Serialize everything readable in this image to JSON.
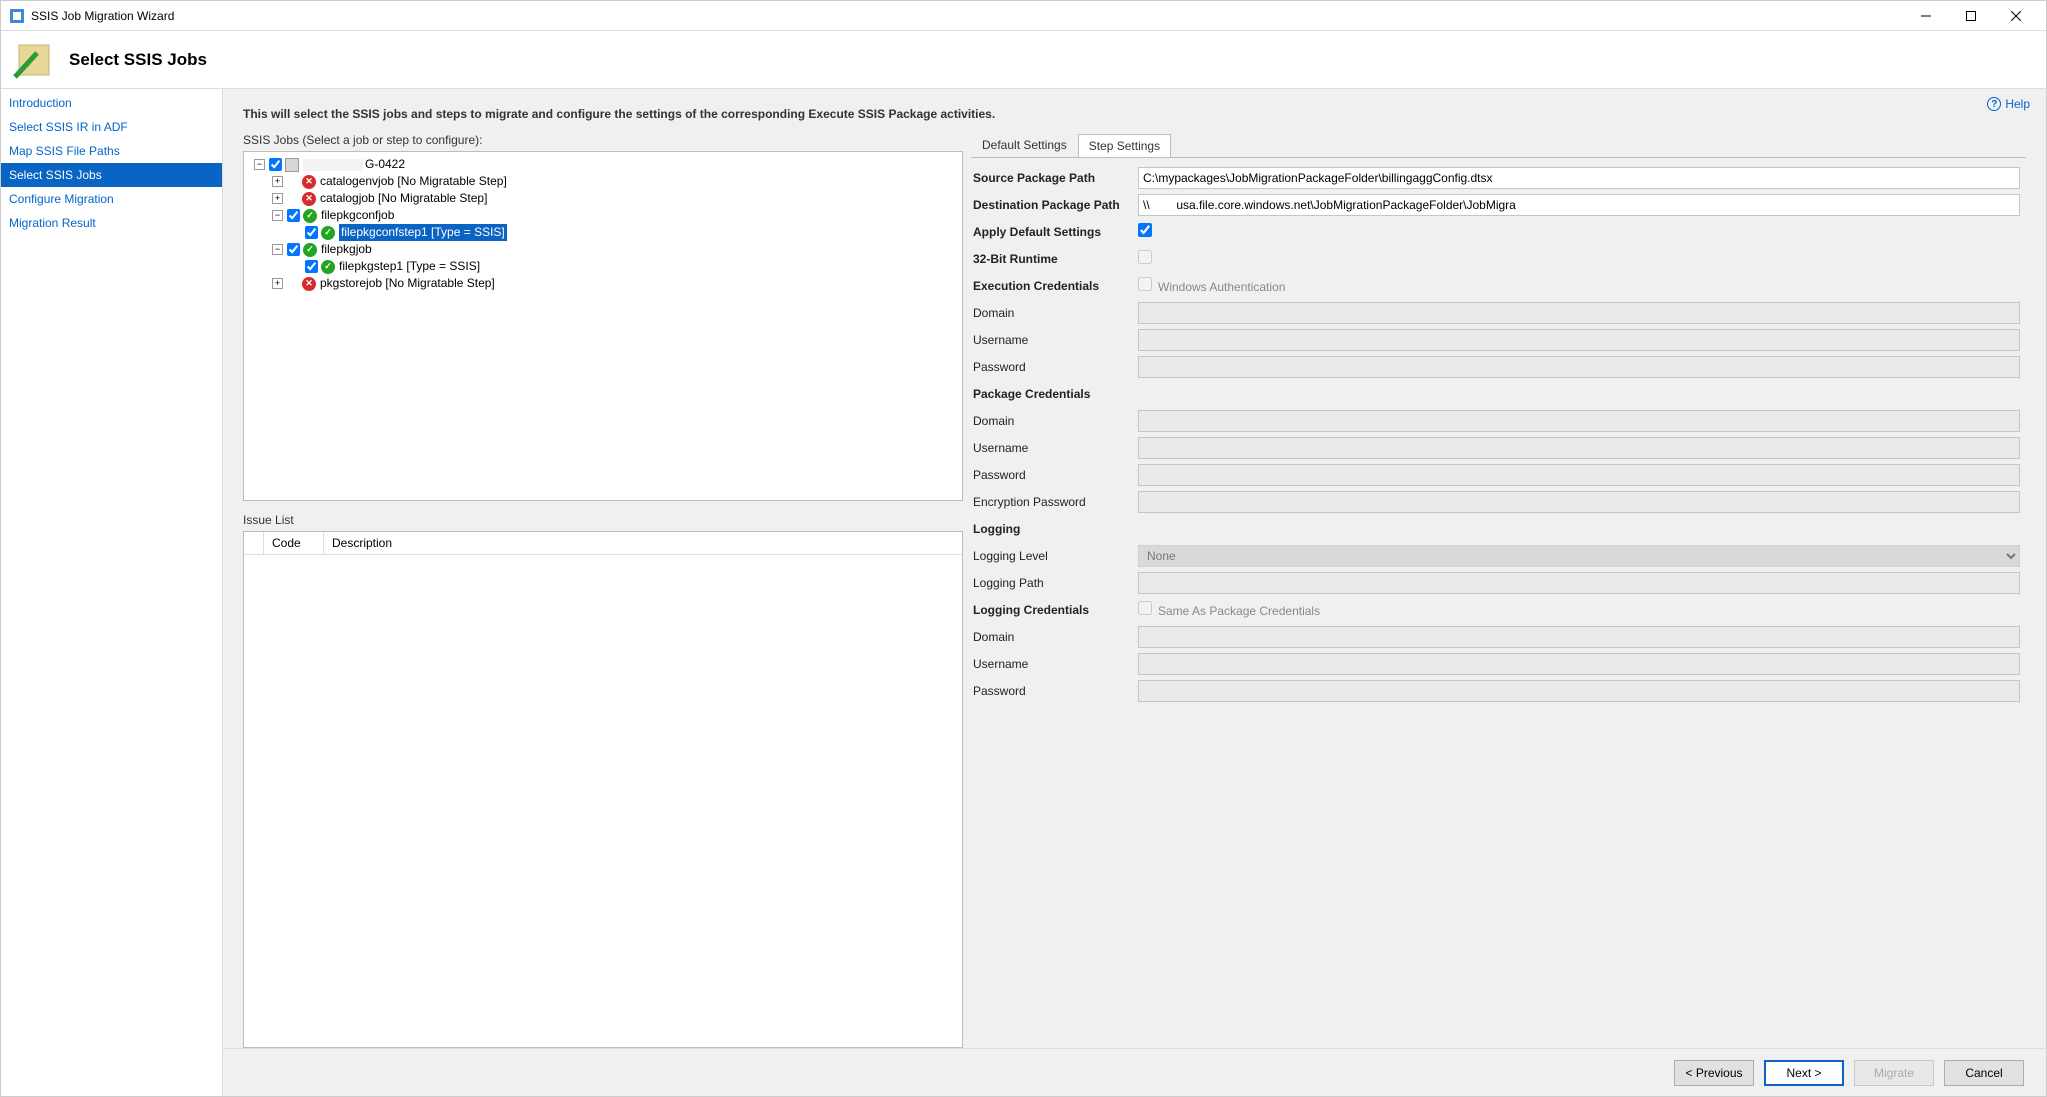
{
  "window_title": "SSIS Job Migration Wizard",
  "page_title": "Select SSIS Jobs",
  "help_label": "Help",
  "nav": {
    "items": [
      {
        "label": "Introduction",
        "active": false
      },
      {
        "label": "Select SSIS IR in ADF",
        "active": false
      },
      {
        "label": "Map SSIS File Paths",
        "active": false
      },
      {
        "label": "Select SSIS Jobs",
        "active": true
      },
      {
        "label": "Configure Migration",
        "active": false
      },
      {
        "label": "Migration Result",
        "active": false
      }
    ]
  },
  "description": "This will select the SSIS jobs and steps to migrate and configure the settings of the corresponding Execute SSIS Package activities.",
  "tree_label": "SSIS Jobs (Select a job or step to configure):",
  "tree": {
    "root": {
      "label": "G-0422",
      "checked": true
    },
    "nodes": [
      {
        "label": "catalogenvjob [No Migratable Step]",
        "status": "bad",
        "exp": "+"
      },
      {
        "label": "catalogjob [No Migratable Step]",
        "status": "bad",
        "exp": "+"
      },
      {
        "label": "filepkgconfjob",
        "status": "ok",
        "checked": true,
        "exp": "-",
        "children": [
          {
            "label": "filepkgconfstep1 [Type = SSIS]",
            "status": "ok",
            "checked": true,
            "selected": true
          }
        ]
      },
      {
        "label": "filepkgjob",
        "status": "ok",
        "checked": true,
        "exp": "-",
        "children": [
          {
            "label": "filepkgstep1 [Type = SSIS]",
            "status": "ok",
            "checked": true
          }
        ]
      },
      {
        "label": "pkgstorejob [No Migratable Step]",
        "status": "bad",
        "exp": "+"
      }
    ]
  },
  "issue_title": "Issue List",
  "issue_cols": {
    "code": "Code",
    "desc": "Description"
  },
  "tabs": {
    "default": "Default Settings",
    "step": "Step Settings"
  },
  "form": {
    "source_path": {
      "label": "Source Package Path",
      "value": "C:\\mypackages\\JobMigrationPackageFolder\\billingaggConfig.dtsx"
    },
    "dest_path": {
      "label": "Destination Package Path",
      "value": "\\\\        usa.file.core.windows.net\\JobMigrationPackageFolder\\JobMigra"
    },
    "apply_defaults": {
      "label": "Apply Default Settings",
      "checked": true
    },
    "runtime32": {
      "label": "32-Bit Runtime",
      "checked": false
    },
    "exec_cred": {
      "label": "Execution Credentials",
      "chk_label": "Windows Authentication"
    },
    "exec_domain": {
      "label": "Domain",
      "value": ""
    },
    "exec_user": {
      "label": "Username",
      "value": ""
    },
    "exec_pass": {
      "label": "Password",
      "value": ""
    },
    "pkg_cred": {
      "label": "Package Credentials"
    },
    "pkg_domain": {
      "label": "Domain",
      "value": ""
    },
    "pkg_user": {
      "label": "Username",
      "value": ""
    },
    "pkg_pass": {
      "label": "Password",
      "value": ""
    },
    "enc_pass": {
      "label": "Encryption Password",
      "value": ""
    },
    "logging": {
      "label": "Logging"
    },
    "log_level": {
      "label": "Logging Level",
      "value": "None"
    },
    "log_path": {
      "label": "Logging Path",
      "value": ""
    },
    "log_cred": {
      "label": "Logging Credentials",
      "chk_label": "Same As Package Credentials"
    },
    "log_domain": {
      "label": "Domain",
      "value": ""
    },
    "log_user": {
      "label": "Username",
      "value": ""
    },
    "log_pass": {
      "label": "Password",
      "value": ""
    }
  },
  "buttons": {
    "prev": "< Previous",
    "next": "Next >",
    "migrate": "Migrate",
    "cancel": "Cancel"
  }
}
